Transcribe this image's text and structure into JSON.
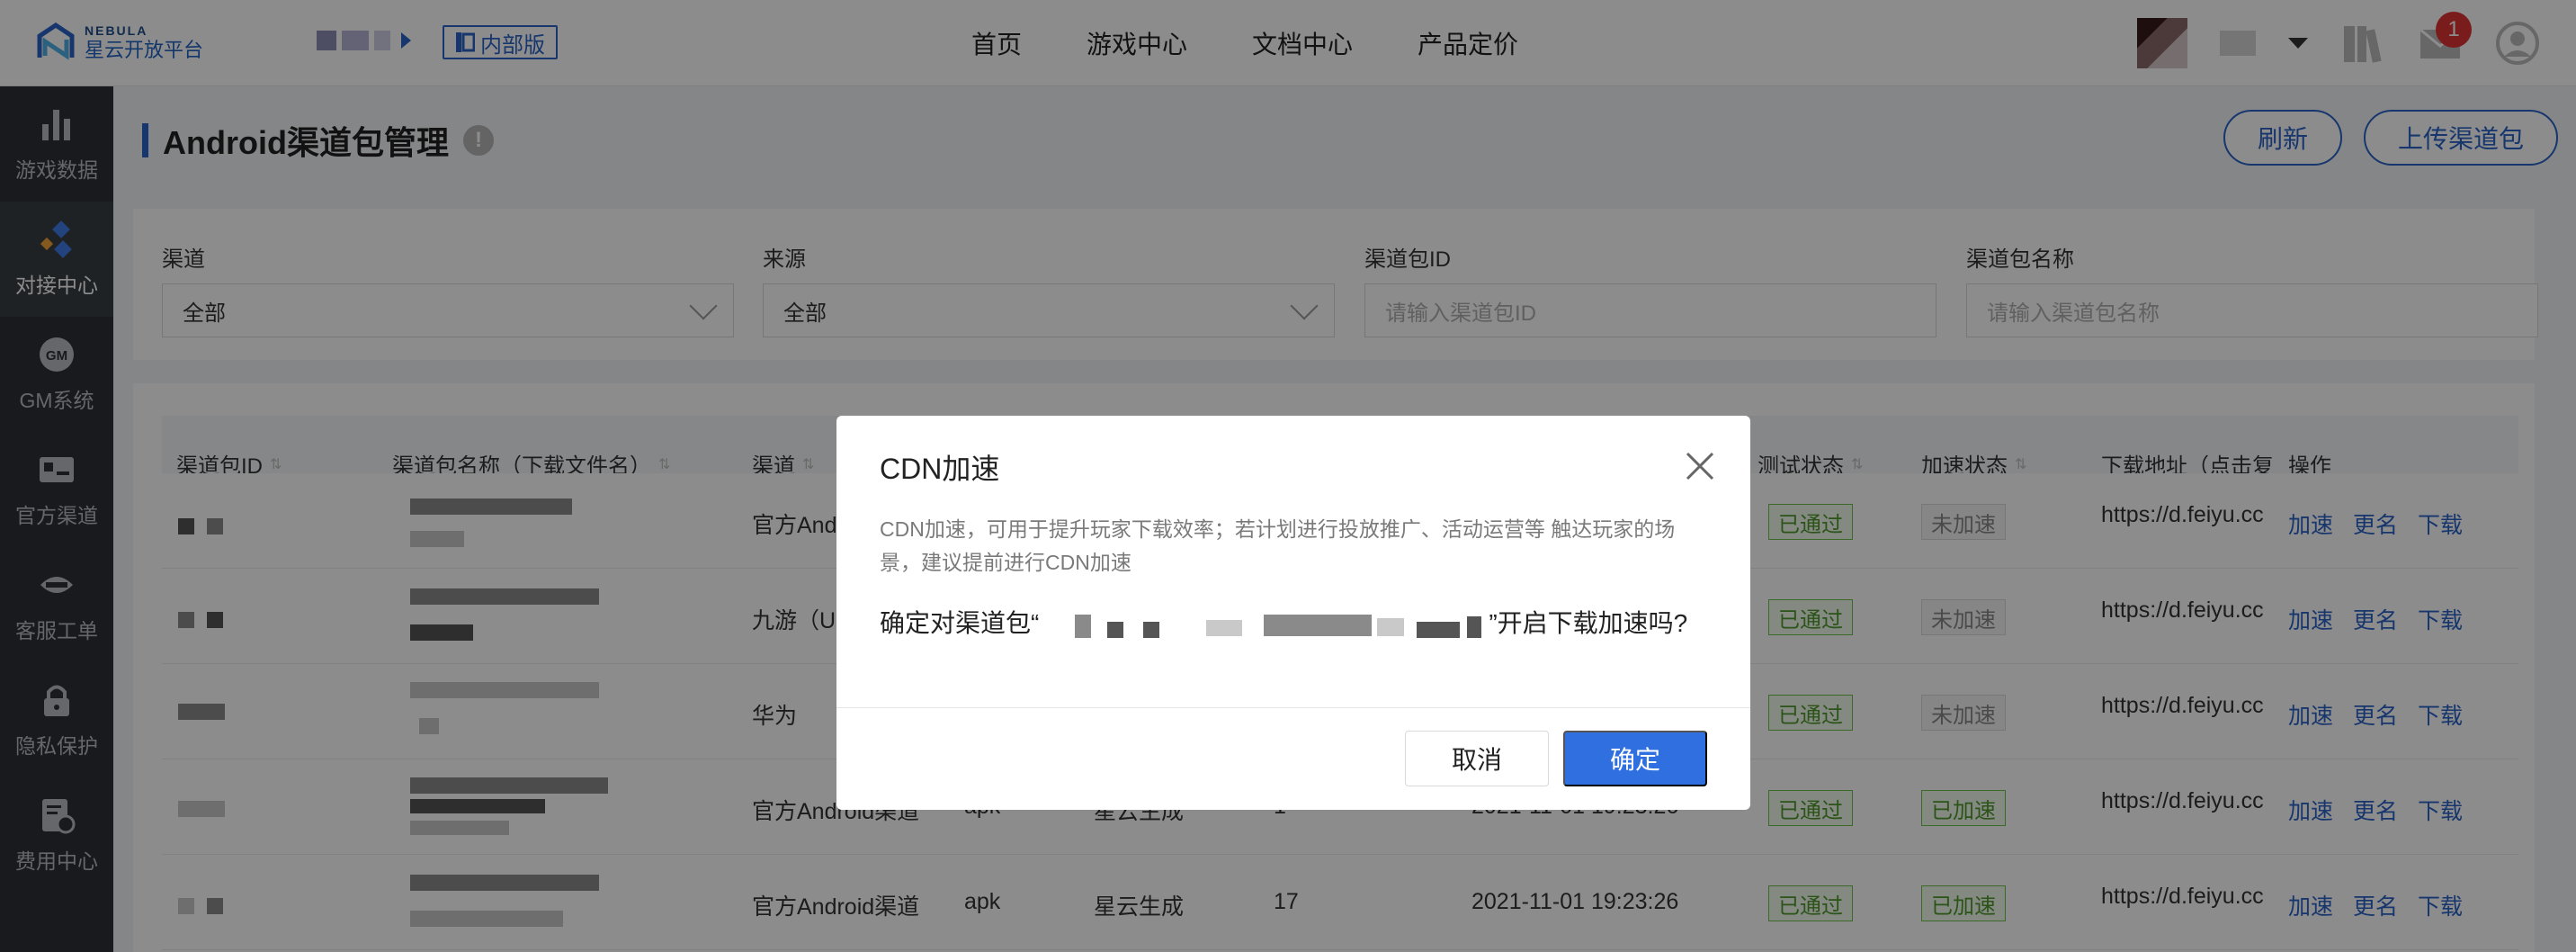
{
  "logo": {
    "en": "NEBULA",
    "cn": "星云开放平台"
  },
  "edition_tag": "内部版",
  "nav": [
    "首页",
    "游戏中心",
    "文档中心",
    "产品定价"
  ],
  "notifications": {
    "count": "1"
  },
  "sidebar": {
    "items": [
      {
        "label": "游戏数据",
        "icon": "bar-chart-icon"
      },
      {
        "label": "对接中心",
        "icon": "integration-icon",
        "active": true
      },
      {
        "label": "GM系统",
        "icon": "gm-icon"
      },
      {
        "label": "官方渠道",
        "icon": "id-card-icon"
      },
      {
        "label": "客服工单",
        "icon": "headset-icon"
      },
      {
        "label": "隐私保护",
        "icon": "lock-icon"
      },
      {
        "label": "费用中心",
        "icon": "billing-icon"
      }
    ]
  },
  "page": {
    "title": "Android渠道包管理",
    "refresh_label": "刷新",
    "upload_label": "上传渠道包"
  },
  "filters": {
    "channel": {
      "label": "渠道",
      "value": "全部"
    },
    "source": {
      "label": "来源",
      "value": "全部"
    },
    "package_id": {
      "label": "渠道包ID",
      "placeholder": "请输入渠道包ID"
    },
    "package_name": {
      "label": "渠道包名称",
      "placeholder": "请输入渠道包名称"
    }
  },
  "table": {
    "headers": {
      "id": "渠道包ID",
      "name": "渠道包名称（下载文件名）",
      "channel": "渠道",
      "test_status": "测试状态",
      "speed_status": "加速状态",
      "download_url": "下载地址（点击复",
      "actions": "操作"
    },
    "rows": [
      {
        "channel": "官方Andr",
        "test": "已通过",
        "speed": "未加速",
        "url": "https://d.feiyu.cc",
        "speed_tag": "none"
      },
      {
        "channel": "九游（UC",
        "test": "已通过",
        "speed": "未加速",
        "url": "https://d.feiyu.cc",
        "speed_tag": "none"
      },
      {
        "channel": "华为",
        "test": "已通过",
        "speed": "未加速",
        "url": "https://d.feiyu.cc",
        "speed_tag": "none"
      },
      {
        "channel": "官方Android渠道",
        "test": "已通过",
        "speed": "已加速",
        "url": "https://d.feiyu.cc",
        "speed_tag": "pass"
      },
      {
        "channel": "官方Android渠道",
        "type": "apk",
        "source": "星云生成",
        "version": "17",
        "time": "2021-11-01 19:23:26",
        "test": "已通过",
        "speed": "已加速",
        "url": "https://d.feiyu.cc",
        "speed_tag": "pass"
      }
    ],
    "row4_partial": {
      "type": "apk",
      "source": "星云生成",
      "version": "1",
      "time": "2021-11-01 19:23:26"
    },
    "action_labels": {
      "speed": "加速",
      "rename": "更名",
      "download": "下载"
    }
  },
  "modal": {
    "title": "CDN加速",
    "description": "CDN加速，可用于提升玩家下载效率；若计划进行投放推广、活动运营等 触达玩家的场景，建议提前进行CDN加速",
    "confirm_prefix": "确定对渠道包“",
    "confirm_suffix": "”开启下载加速吗?",
    "cancel_label": "取消",
    "ok_label": "确定"
  },
  "colors": {
    "primary": "#2a63c7",
    "ok_button": "#2f6fe0",
    "sidebar_bg": "#2d3035",
    "badge": "#e03434",
    "success": "#4f9a2c"
  }
}
